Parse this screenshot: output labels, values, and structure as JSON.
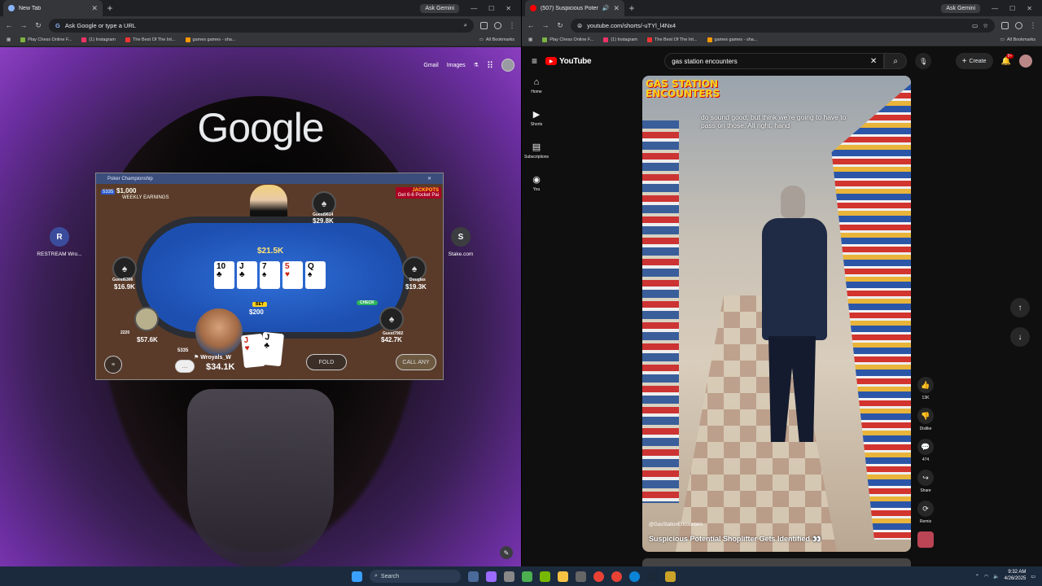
{
  "left_browser": {
    "tab_title": "New Tab",
    "ask_gemini": "Ask Gemini",
    "omnibox_placeholder": "Ask Google or type a URL",
    "bookmarks": [
      "Play Chess Online F...",
      "(1) Instagram",
      "The Best Of The Int...",
      "games games - sha..."
    ],
    "all_bookmarks": "All Bookmarks",
    "google_links": [
      "Gmail",
      "Images"
    ],
    "google_logo": "Google",
    "shortcuts": [
      {
        "label": "RESTREAM Wro...",
        "letter": "R"
      },
      {
        "label": "Stake.com",
        "letter": "S"
      }
    ]
  },
  "poker": {
    "window_title": "Poker Championship",
    "level_badge": "5335",
    "weekly_amount": "$1,000",
    "weekly_label": "WEEKLY EARNINGS",
    "jackpot_line1": "JACKPOTS",
    "jackpot_line2": "Get 6-6 Pocket Pai",
    "pot": "$21.5K",
    "board_cards": [
      {
        "rank": "10",
        "suit": "♣",
        "red": false
      },
      {
        "rank": "J",
        "suit": "♣",
        "red": false
      },
      {
        "rank": "7",
        "suit": "♠",
        "red": false
      },
      {
        "rank": "5",
        "suit": "♥",
        "red": true
      },
      {
        "rank": "Q",
        "suit": "♠",
        "red": false
      }
    ],
    "players": [
      {
        "name": "Guest9614",
        "stack": "$29.8K"
      },
      {
        "name": "Guest6306",
        "stack": "$16.9K"
      },
      {
        "name": "Douglas",
        "stack": "$19.3K"
      },
      {
        "name": "2220",
        "stack": "$57.6K"
      },
      {
        "name": "Guest7902",
        "stack": "$42.7K"
      }
    ],
    "bet_label": "BET",
    "bet_amount": "$200",
    "check_label": "CHECK",
    "hero_name": "Wroyals_W",
    "hero_level": "5335",
    "hero_stack": "$34.1K",
    "hero_cards": [
      {
        "rank": "J",
        "suit": "♥"
      },
      {
        "rank": "J",
        "suit": "♣"
      }
    ],
    "fold": "FOLD",
    "call_any": "CALL ANY",
    "chat_icon": "chat-icon"
  },
  "right_browser": {
    "tab_title": "(507) Suspicious Potential S...",
    "ask_gemini": "Ask Gemini",
    "url": "youtube.com/shorts/-uTYl_l4Nx4",
    "bookmarks": [
      "Play Chess Online F...",
      "(1) Instagram",
      "The Best Of The Int...",
      "games games - sha..."
    ],
    "all_bookmarks": "All Bookmarks"
  },
  "youtube": {
    "logo": "YouTube",
    "search_value": "gas station encounters",
    "create": "Create",
    "notif_count": "9+",
    "sidebar": [
      "Home",
      "Shorts",
      "Subscriptions",
      "You"
    ],
    "overlay_brand": "GAS STATION ENCOUNTERS",
    "caption": "do sound good, but think we're going to have to pass on those. All right, hand",
    "channel": "@GasStationEncounters",
    "video_title": "Suspicious Potential Shoplifter Gets Identified 👀",
    "actions": [
      {
        "icon": "like-icon",
        "label": "13K"
      },
      {
        "icon": "dislike-icon",
        "label": "Dislike"
      },
      {
        "icon": "comment-icon",
        "label": "474"
      },
      {
        "icon": "share-icon",
        "label": "Share"
      },
      {
        "icon": "remix-icon",
        "label": "Remix"
      }
    ]
  },
  "taskbar": {
    "search": "Search",
    "time": "9:32 AM",
    "date": "4/26/2025"
  }
}
